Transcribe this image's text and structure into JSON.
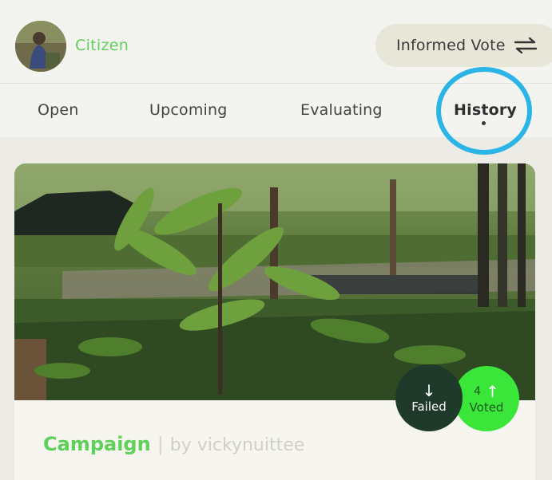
{
  "header": {
    "user_name": "Citizen",
    "vote_mode_label": "Informed Vote"
  },
  "tabs": [
    {
      "label": "Open",
      "active": false
    },
    {
      "label": "Upcoming",
      "active": false
    },
    {
      "label": "Evaluating",
      "active": false
    },
    {
      "label": "History",
      "active": true
    }
  ],
  "card": {
    "title": "Campaign",
    "separator": "|",
    "author": "by vickynuittee",
    "status_badge": {
      "label": "Failed",
      "icon": "arrow-down-icon"
    },
    "vote_badge": {
      "count": "4",
      "label": "Voted",
      "icon": "arrow-up-icon"
    }
  },
  "colors": {
    "accent_green": "#5fd05a",
    "voted_green": "#3ae63a",
    "failed_dark": "#1f3a2a",
    "highlight_ring": "#2bb5e6"
  }
}
